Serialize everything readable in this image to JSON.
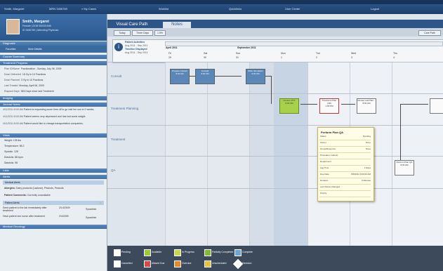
{
  "topbar": {
    "items": [
      "Smith, Margaret",
      "MRN 3456789",
      "My Cases",
      "Worklist",
      "Quicklinks",
      "User Center",
      "Logout"
    ]
  },
  "patient": {
    "name": "Smith, Margaret",
    "line1": "Female | DOB 05/03/1948",
    "line2": "ID 3456789 | Attending Physician"
  },
  "left": {
    "section_diagnosis": "Diagnosis",
    "diagnosis_items": [
      "Favorites",
      "More Details"
    ],
    "section_course": "Course Summary",
    "section_progress": "Treatment Progress",
    "progress_rows": [
      {
        "label": "Plan ID/Name",
        "value": "Fractionation - Sunday, July 06, 2009"
      },
      {
        "label": "Dose Delivered",
        "value": "18 Gy in 10 Fractions"
      },
      {
        "label": "Dose Planned",
        "value": "3 Gy in 10 Fractions"
      },
      {
        "label": "Last Treated",
        "value": "Monday, April 06, 2009"
      },
      {
        "label": "Elapsed Days",
        "value": "365 Days since last Treatment"
      }
    ],
    "section_imaging": "Imaging",
    "section_journal": "Journal Notes",
    "journal_rows": [
      {
        "date": "4/11/2011 8:00 AM",
        "text": "Patient is requesting some time off to go visit her son in 2 weeks."
      },
      {
        "date": "4/11/2011 8:00 AM",
        "text": "Patient seems very depressed and has lost some weight."
      },
      {
        "date": "4/11/2011 8:00 AM",
        "text": "Patient would like to change transportation companies."
      }
    ],
    "section_vitals": "Vitals",
    "vitals": [
      "Weight: 135 lbs",
      "Temperature: 98.2",
      "Systolic: 128",
      "Diastolic: 88 bpm",
      "Diastolic: 98"
    ],
    "section_labs": "Labs",
    "section_alerts": "Alerts",
    "alerts_sub": "Medical Alerts",
    "allergies_label": "Allergies:",
    "allergies_value": "Dairy products (Lactose), Peanuts, Peanuts",
    "comments_label": "Patient Comments:",
    "comments_value": "Currently unavailable",
    "patient_alerts": "Patient Alerts",
    "alerts_rows": [
      {
        "text": "Send patient to the lab immediately after treatment",
        "date": "2/14/2009",
        "by": "Sysadmin"
      },
      {
        "text": "Have patient see nurse after treatment",
        "date": "2/4/2009",
        "by": "Sysadmin"
      }
    ],
    "section_oncology": "Medical Oncology"
  },
  "main": {
    "tabs": [
      "Visual Care Path",
      "Notes"
    ],
    "toolbar": {
      "today": "Today",
      "three_days": "Three Days",
      "zoom": "1.5%",
      "right_btn": "Care Path"
    },
    "timeline": {
      "header1": "Patient Activities",
      "row1": "Aug 2011 - Sep 2011",
      "header2": "Timeline Displayed",
      "row2": "Aug 2011 - Sep 2011",
      "months": [
        "April 2011",
        "September 2011"
      ],
      "days": [
        "Fri",
        "Sat",
        "Sun",
        "Mon",
        "Tue",
        "Wed",
        "Thu"
      ],
      "dates": [
        "29",
        "30",
        "31",
        "1",
        "2",
        "3",
        "4"
      ]
    },
    "lanes": [
      "Consult",
      "Treatment Planning",
      "Treatment",
      "QA"
    ],
    "nodes": [
      {
        "title": "Prepare Consult",
        "time": "8:00 AM"
      },
      {
        "title": "Consult",
        "time": "8:00 AM"
      },
      {
        "title": "Write Simulation",
        "time": "9:00 AM"
      },
      {
        "title": "Contour PTV",
        "time": "8:00 AM"
      },
      {
        "title": "Treatment Plan (4D)",
        "time": "1:00 PM"
      },
      {
        "title": "Review and Plan...",
        "time": "8:00 AM"
      },
      {
        "title": "Perform Plan QA",
        "time": "8:00 AM"
      }
    ],
    "popup": {
      "title": "Perform Plan QA",
      "rows": [
        {
          "k": "Status",
          "v": "Pending"
        },
        {
          "k": "Owner",
          "v": "None"
        },
        {
          "k": "Group/Resource",
          "v": "None"
        },
        {
          "k": "Procedure Code(s)",
          "v": ""
        },
        {
          "k": "Department",
          "v": ""
        },
        {
          "k": "Lag Time",
          "v": "1 Days"
        },
        {
          "k": "Due Date",
          "v": "8/8/2011 9:00:00 AM"
        },
        {
          "k": "Duration",
          "v": "0 Minutes"
        },
        {
          "k": "Last Status Changed",
          "v": ""
        },
        {
          "k": "Priority",
          "v": ""
        }
      ]
    }
  },
  "legend": {
    "row1": [
      "Pending",
      "Available",
      "In Progress",
      "Partially Completed",
      "Complete"
    ],
    "row2": [
      "Cancelled",
      "Missed Due",
      "Overdue",
      "Unscheduled",
      "Decision"
    ]
  },
  "colors": {
    "accent": "#2e5587",
    "pending": "#ffffff",
    "available": "#9cc93c",
    "in_progress": "#c6d84a",
    "partial": "#87b634",
    "complete": "#6aa7d8",
    "cancelled": "#ffffff",
    "missed": "#d04a4a",
    "overdue": "#e28a2a",
    "unscheduled": "#e2c640",
    "decision": "#ffffff"
  }
}
